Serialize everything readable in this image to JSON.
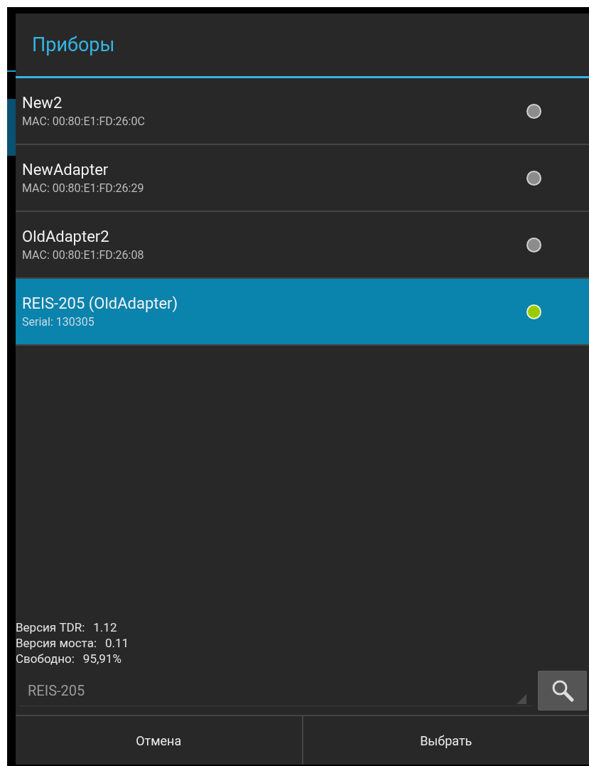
{
  "dialog": {
    "title": "Приборы"
  },
  "devices": [
    {
      "name": "New2",
      "detail": "MAC: 00:80:E1:FD:26:0C",
      "selected": false
    },
    {
      "name": "NewAdapter",
      "detail": "MAC: 00:80:E1:FD:26:29",
      "selected": false
    },
    {
      "name": "OldAdapter2",
      "detail": "MAC: 00:80:E1:FD:26:08",
      "selected": false
    },
    {
      "name": "REIS-205 (OldAdapter)",
      "detail": "Serial: 130305",
      "selected": true
    }
  ],
  "info": [
    {
      "label": "Версия TDR:",
      "value": "1.12"
    },
    {
      "label": "Версия моста:",
      "value": "0.11"
    },
    {
      "label": "Свободно:",
      "value": "95,91%"
    }
  ],
  "device_spinner": {
    "value": "REIS-205"
  },
  "buttons": [
    "Отмена",
    "Выбрать"
  ]
}
